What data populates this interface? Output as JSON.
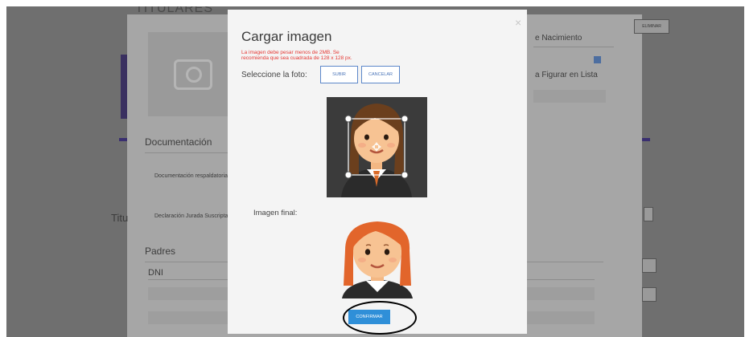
{
  "background": {
    "section_title": "TITULARES",
    "documentation_heading": "Documentación",
    "doc_item_1": "Documentación respaldatoria",
    "doc_item_2": "Declaración Jurada Suscripta",
    "titular_heading": "Titu",
    "padres_heading": "Padres",
    "dni_label": "DNI",
    "birth_label": "e Nacimiento",
    "list_label": "a Figurar en Lista",
    "eliminar_label": "ELIMINAR"
  },
  "modal": {
    "title": "Cargar imagen",
    "close_glyph": "×",
    "warning_line1": "La imagen debe pesar menos de 2MB. Se",
    "warning_line2": "recomienda que sea cuadrada de 128 x 128 px.",
    "select_label": "Seleccione la foto:",
    "upload_button": "SUBIR",
    "cancel_button": "CANCELAR",
    "final_label": "Imagen final:",
    "confirm_button": "CONFIRMAR"
  },
  "colors": {
    "accent": "#2f8fd8",
    "warning": "#e53935",
    "overlay": "#6f6f6f"
  },
  "icons": {
    "photo_placeholder": "camera-icon",
    "calendar": "calendar-icon",
    "close": "close-icon"
  }
}
